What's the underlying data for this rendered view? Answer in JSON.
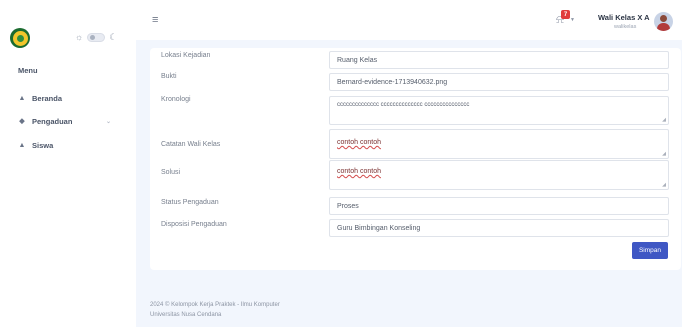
{
  "sidebar": {
    "theme_toggle": {
      "sun_icon": "sun-icon",
      "moon_icon": "moon-icon"
    },
    "menu_title": "Menu",
    "items": [
      {
        "label": "Beranda",
        "icon": "home-icon"
      },
      {
        "label": "Pengaduan",
        "icon": "layers-icon",
        "has_chevron": true
      },
      {
        "label": "Siswa",
        "icon": "home-icon"
      }
    ]
  },
  "header": {
    "menu_icon": "hamburger-icon",
    "notification_count": "7",
    "user_name": "Wali Kelas X A",
    "user_role": "walikelas"
  },
  "form": {
    "rows": [
      {
        "label": "Lokasi Kejadian",
        "value": "Ruang Kelas"
      },
      {
        "label": "Bukti",
        "value": "Bernard-evidence-1713940632.png"
      },
      {
        "label": "Kronologi",
        "value": "cccccccccccccc cccccccccccccc ccccccccccccccc"
      },
      {
        "label": "Catatan Wali Kelas",
        "value": "contoh contoh"
      },
      {
        "label": "Solusi",
        "value": "contoh contoh"
      },
      {
        "label": "Status Pengaduan",
        "value": "Proses"
      },
      {
        "label": "Disposisi Pengaduan",
        "value": "Guru Bimbingan Konseling"
      }
    ],
    "save_label": "Simpan"
  },
  "footer": {
    "line1": "2024 © Kelompok Kerja Praktek - Ilmu Komputer",
    "line2": "Universitas Nusa Cendana"
  },
  "colors": {
    "primary": "#3f57c4",
    "background": "#f2f6fd",
    "badge": "#e03c3c"
  }
}
